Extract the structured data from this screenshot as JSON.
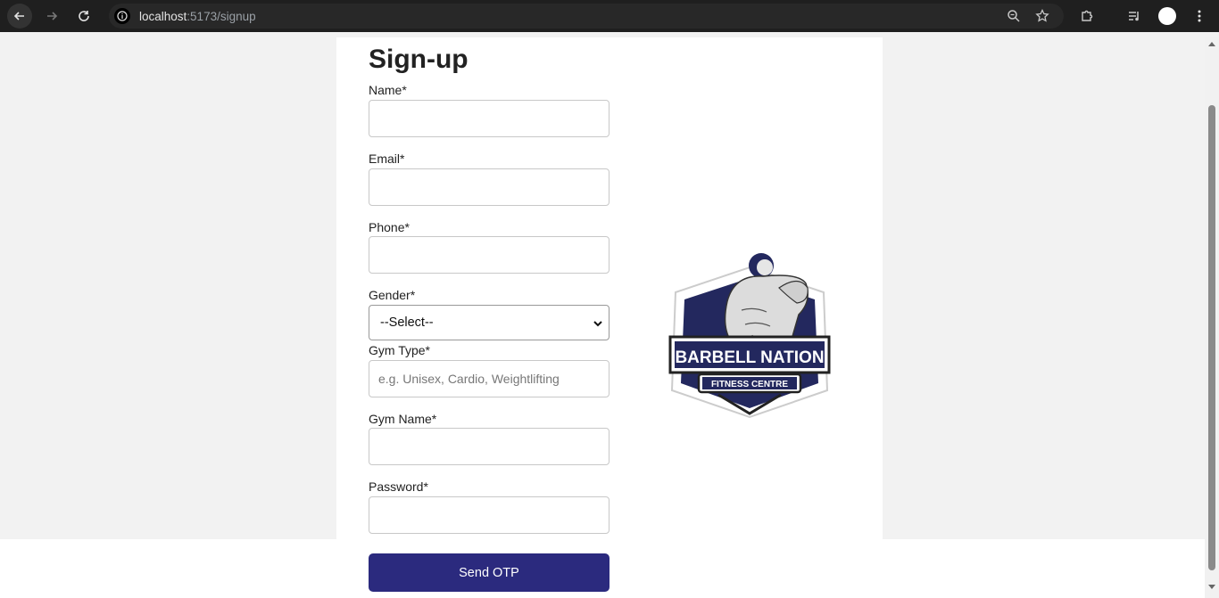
{
  "browser": {
    "url_host": "localhost",
    "url_path": ":5173/signup"
  },
  "form": {
    "title": "Sign-up",
    "name_label": "Name*",
    "email_label": "Email*",
    "phone_label": "Phone*",
    "gender_label": "Gender*",
    "gender_value": "--Select--",
    "gym_type_label": "Gym Type*",
    "gym_type_placeholder": "e.g. Unisex, Cardio, Weightlifting",
    "gym_name_label": "Gym Name*",
    "password_label": "Password*",
    "submit_label": "Send OTP"
  },
  "logo": {
    "line1": "BARBELL NATION",
    "line2": "FITNESS CENTRE"
  },
  "colors": {
    "button": "#2b2a7e",
    "logo_navy": "#23285e"
  }
}
